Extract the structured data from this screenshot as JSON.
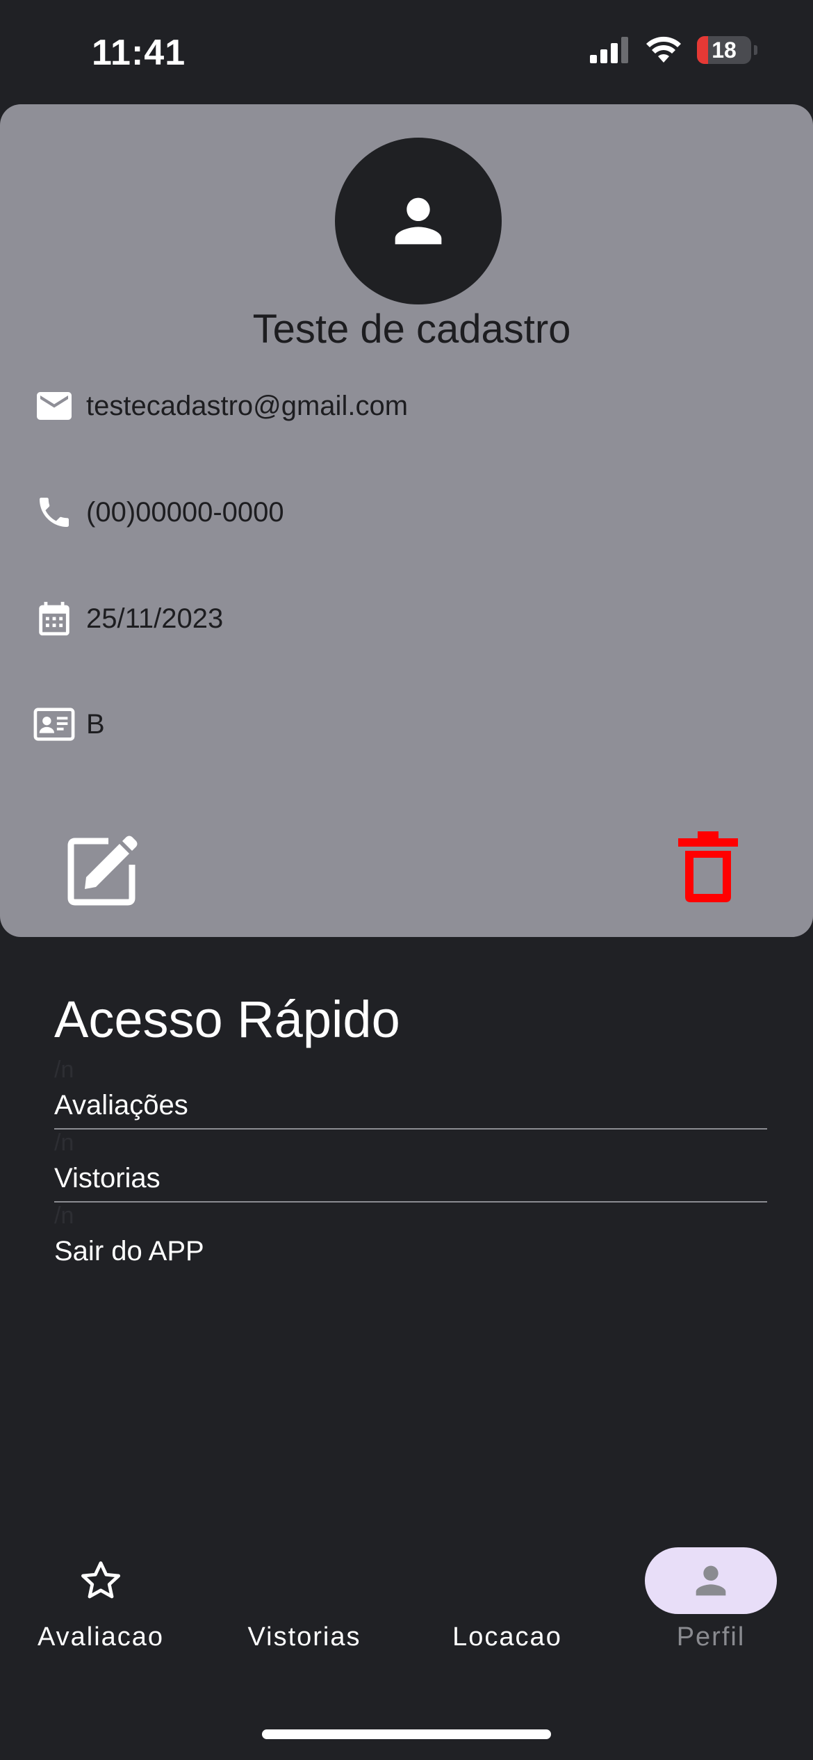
{
  "status_bar": {
    "time": "11:41",
    "battery": "18"
  },
  "profile": {
    "name": "Teste de cadastro",
    "email": "testecadastro@gmail.com",
    "phone": "(00)00000-0000",
    "date": "25/11/2023",
    "license_category": "B"
  },
  "icons": {
    "avatar": "person-icon",
    "email": "mail-icon",
    "phone": "phone-icon",
    "date": "calendar-icon",
    "license": "id-card-icon",
    "edit": "edit-icon",
    "delete": "trash-icon"
  },
  "colors": {
    "background": "#202125",
    "card": "#8f8f97",
    "delete": "#ff0000",
    "nav_active_pill": "#e8def8"
  },
  "quick_access": {
    "title": "Acesso Rápido",
    "items": [
      {
        "marker": "/n",
        "label": "Avaliações"
      },
      {
        "marker": "/n",
        "label": "Vistorias"
      },
      {
        "marker": "/n",
        "label": "Sair do APP"
      }
    ]
  },
  "bottom_nav": {
    "items": [
      {
        "label": "Avaliacao",
        "icon": "star-outline-icon"
      },
      {
        "label": "Vistorias",
        "icon": ""
      },
      {
        "label": "Locacao",
        "icon": ""
      },
      {
        "label": "Perfil",
        "icon": "person-icon",
        "active": true
      }
    ]
  }
}
